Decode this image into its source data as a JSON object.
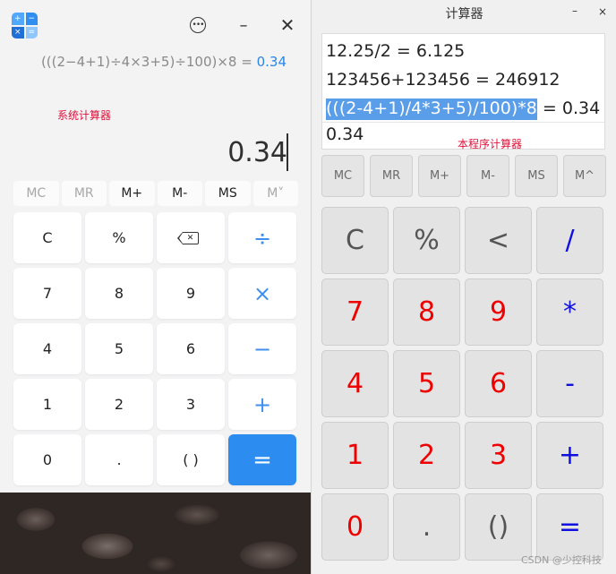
{
  "system_calc": {
    "logo_glyphs": [
      "+",
      "−",
      "×",
      "="
    ],
    "expression": "(((2−4+1)÷4×3+5)÷100)×8 =",
    "expression_result": "0.34",
    "annotation": "系统计算器",
    "display": "0.34",
    "memory_keys": [
      {
        "label": "MC",
        "enabled": false
      },
      {
        "label": "MR",
        "enabled": false
      },
      {
        "label": "M+",
        "enabled": true
      },
      {
        "label": "M-",
        "enabled": true
      },
      {
        "label": "MS",
        "enabled": true
      },
      {
        "label": "M˅",
        "enabled": false
      }
    ],
    "keys": [
      "C",
      "%",
      "",
      "÷",
      "7",
      "8",
      "9",
      "×",
      "4",
      "5",
      "6",
      "−",
      "1",
      "2",
      "3",
      "+",
      "0",
      ".",
      "( )",
      "="
    ],
    "titlebar": {
      "minimize": "–",
      "close": "✕",
      "menu": "•••"
    }
  },
  "custom_calc": {
    "title": "计算器",
    "window_controls": {
      "minimize": "–",
      "close": "×"
    },
    "history": [
      {
        "text": "12.25/2 = 6.125"
      },
      {
        "text": "123456+123456 = 246912"
      },
      {
        "selected": "(((2-4+1)/4*3+5)/100)*8",
        "rest": " = 0.34"
      }
    ],
    "result": "0.34",
    "annotation": "本程序计算器",
    "memory_keys": [
      "MC",
      "MR",
      "M+",
      "M-",
      "MS",
      "M^"
    ],
    "keys": [
      {
        "label": "C",
        "kind": "func"
      },
      {
        "label": "%",
        "kind": "func"
      },
      {
        "label": "<",
        "kind": "func"
      },
      {
        "label": "/",
        "kind": "op"
      },
      {
        "label": "7",
        "kind": "num"
      },
      {
        "label": "8",
        "kind": "num"
      },
      {
        "label": "9",
        "kind": "num"
      },
      {
        "label": "*",
        "kind": "op"
      },
      {
        "label": "4",
        "kind": "num"
      },
      {
        "label": "5",
        "kind": "num"
      },
      {
        "label": "6",
        "kind": "num"
      },
      {
        "label": "-",
        "kind": "op"
      },
      {
        "label": "1",
        "kind": "num"
      },
      {
        "label": "2",
        "kind": "num"
      },
      {
        "label": "3",
        "kind": "num"
      },
      {
        "label": "+",
        "kind": "op"
      },
      {
        "label": "0",
        "kind": "num"
      },
      {
        "label": ".",
        "kind": "func"
      },
      {
        "label": "()",
        "kind": "func"
      },
      {
        "label": "=",
        "kind": "op"
      }
    ]
  },
  "watermark": "CSDN @少控科技",
  "colors": {
    "accent_blue": "#2d8cf0",
    "annotation_red": "#e0113a",
    "number_red": "#ee0000",
    "operator_blue": "#1010e0"
  }
}
